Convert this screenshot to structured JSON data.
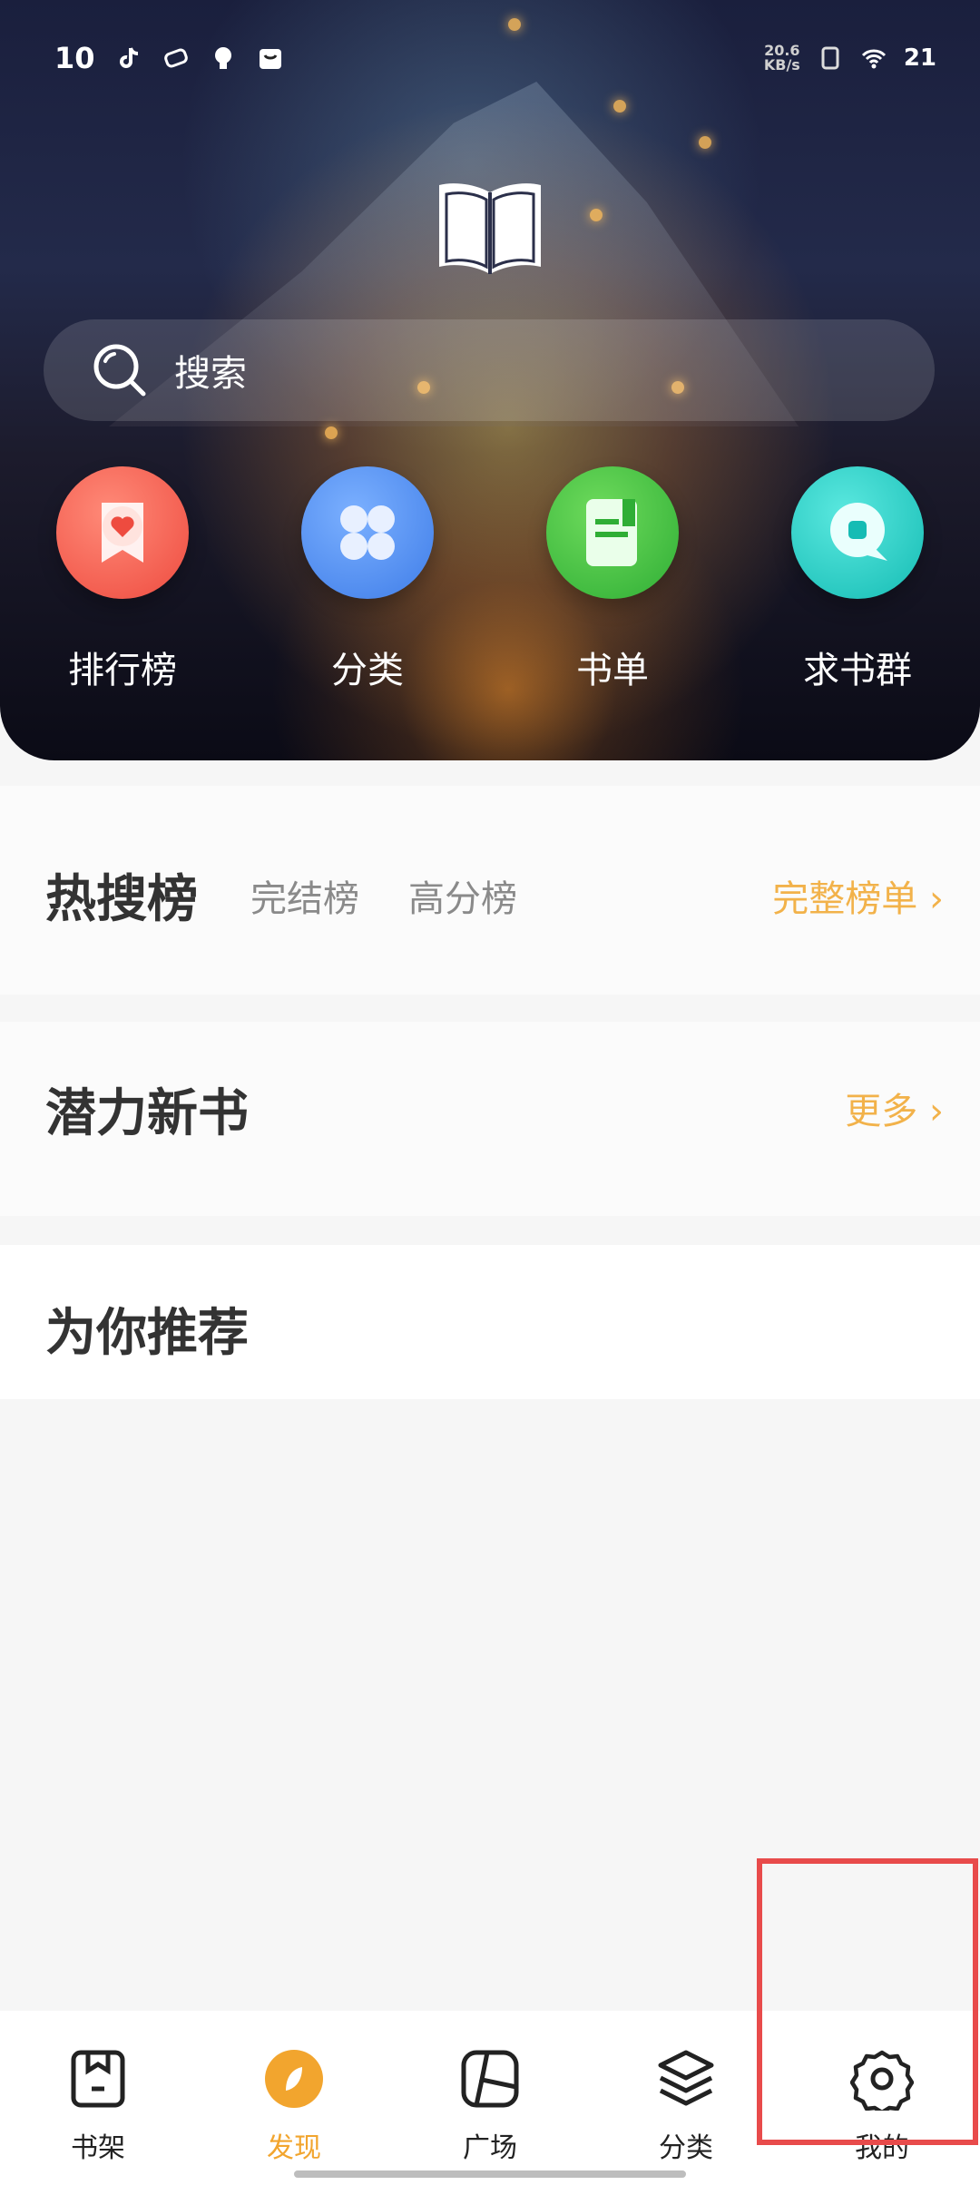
{
  "status_bar": {
    "left_time": "10",
    "net_speed_value": "20.6",
    "net_speed_unit": "KB/s",
    "battery": "21"
  },
  "search": {
    "placeholder": "搜索"
  },
  "quick_links": [
    {
      "label": "排行榜",
      "icon": "ranking-ribbon-icon",
      "color": "#f25a4e"
    },
    {
      "label": "分类",
      "icon": "category-grid-icon",
      "color": "#4a8cf3"
    },
    {
      "label": "书单",
      "icon": "booklist-icon",
      "color": "#38b93d"
    },
    {
      "label": "求书群",
      "icon": "chat-group-icon",
      "color": "#22c6c0"
    }
  ],
  "hot_section": {
    "title": "热搜榜",
    "tabs": [
      "完结榜",
      "高分榜"
    ],
    "more": "完整榜单"
  },
  "new_section": {
    "title": "潜力新书",
    "more": "更多"
  },
  "recommend_section": {
    "title": "为你推荐"
  },
  "bottom_nav": [
    {
      "label": "书架",
      "icon": "bookshelf-icon",
      "active": false
    },
    {
      "label": "发现",
      "icon": "discover-compass-icon",
      "active": true
    },
    {
      "label": "广场",
      "icon": "square-plaza-icon",
      "active": false
    },
    {
      "label": "分类",
      "icon": "layers-category-icon",
      "active": false
    },
    {
      "label": "我的",
      "icon": "settings-gear-icon",
      "active": false
    }
  ],
  "colors": {
    "accent": "#f2a52e",
    "highlight": "#e84b4b"
  }
}
